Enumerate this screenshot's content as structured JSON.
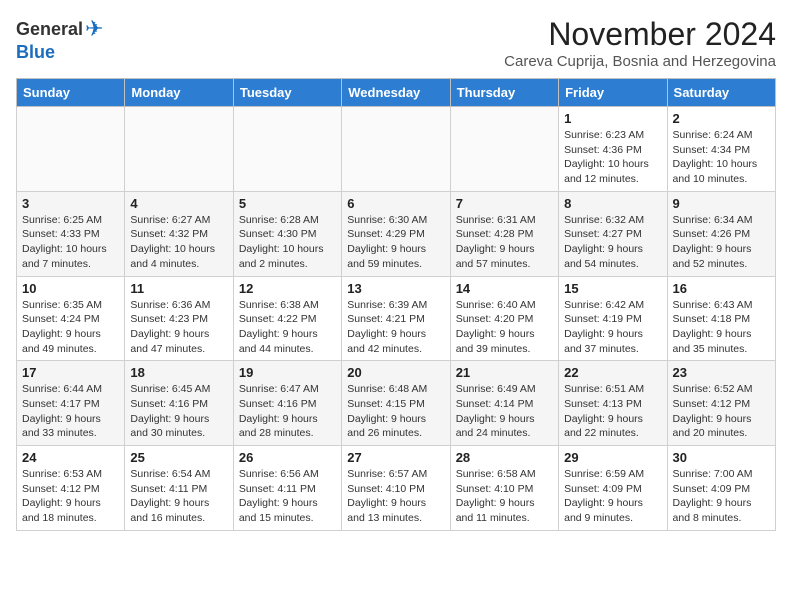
{
  "logo": {
    "general": "General",
    "blue": "Blue"
  },
  "title": "November 2024",
  "subtitle": "Careva Cuprija, Bosnia and Herzegovina",
  "days_of_week": [
    "Sunday",
    "Monday",
    "Tuesday",
    "Wednesday",
    "Thursday",
    "Friday",
    "Saturday"
  ],
  "weeks": [
    [
      {
        "day": "",
        "info": ""
      },
      {
        "day": "",
        "info": ""
      },
      {
        "day": "",
        "info": ""
      },
      {
        "day": "",
        "info": ""
      },
      {
        "day": "",
        "info": ""
      },
      {
        "day": "1",
        "info": "Sunrise: 6:23 AM\nSunset: 4:36 PM\nDaylight: 10 hours and 12 minutes."
      },
      {
        "day": "2",
        "info": "Sunrise: 6:24 AM\nSunset: 4:34 PM\nDaylight: 10 hours and 10 minutes."
      }
    ],
    [
      {
        "day": "3",
        "info": "Sunrise: 6:25 AM\nSunset: 4:33 PM\nDaylight: 10 hours and 7 minutes."
      },
      {
        "day": "4",
        "info": "Sunrise: 6:27 AM\nSunset: 4:32 PM\nDaylight: 10 hours and 4 minutes."
      },
      {
        "day": "5",
        "info": "Sunrise: 6:28 AM\nSunset: 4:30 PM\nDaylight: 10 hours and 2 minutes."
      },
      {
        "day": "6",
        "info": "Sunrise: 6:30 AM\nSunset: 4:29 PM\nDaylight: 9 hours and 59 minutes."
      },
      {
        "day": "7",
        "info": "Sunrise: 6:31 AM\nSunset: 4:28 PM\nDaylight: 9 hours and 57 minutes."
      },
      {
        "day": "8",
        "info": "Sunrise: 6:32 AM\nSunset: 4:27 PM\nDaylight: 9 hours and 54 minutes."
      },
      {
        "day": "9",
        "info": "Sunrise: 6:34 AM\nSunset: 4:26 PM\nDaylight: 9 hours and 52 minutes."
      }
    ],
    [
      {
        "day": "10",
        "info": "Sunrise: 6:35 AM\nSunset: 4:24 PM\nDaylight: 9 hours and 49 minutes."
      },
      {
        "day": "11",
        "info": "Sunrise: 6:36 AM\nSunset: 4:23 PM\nDaylight: 9 hours and 47 minutes."
      },
      {
        "day": "12",
        "info": "Sunrise: 6:38 AM\nSunset: 4:22 PM\nDaylight: 9 hours and 44 minutes."
      },
      {
        "day": "13",
        "info": "Sunrise: 6:39 AM\nSunset: 4:21 PM\nDaylight: 9 hours and 42 minutes."
      },
      {
        "day": "14",
        "info": "Sunrise: 6:40 AM\nSunset: 4:20 PM\nDaylight: 9 hours and 39 minutes."
      },
      {
        "day": "15",
        "info": "Sunrise: 6:42 AM\nSunset: 4:19 PM\nDaylight: 9 hours and 37 minutes."
      },
      {
        "day": "16",
        "info": "Sunrise: 6:43 AM\nSunset: 4:18 PM\nDaylight: 9 hours and 35 minutes."
      }
    ],
    [
      {
        "day": "17",
        "info": "Sunrise: 6:44 AM\nSunset: 4:17 PM\nDaylight: 9 hours and 33 minutes."
      },
      {
        "day": "18",
        "info": "Sunrise: 6:45 AM\nSunset: 4:16 PM\nDaylight: 9 hours and 30 minutes."
      },
      {
        "day": "19",
        "info": "Sunrise: 6:47 AM\nSunset: 4:16 PM\nDaylight: 9 hours and 28 minutes."
      },
      {
        "day": "20",
        "info": "Sunrise: 6:48 AM\nSunset: 4:15 PM\nDaylight: 9 hours and 26 minutes."
      },
      {
        "day": "21",
        "info": "Sunrise: 6:49 AM\nSunset: 4:14 PM\nDaylight: 9 hours and 24 minutes."
      },
      {
        "day": "22",
        "info": "Sunrise: 6:51 AM\nSunset: 4:13 PM\nDaylight: 9 hours and 22 minutes."
      },
      {
        "day": "23",
        "info": "Sunrise: 6:52 AM\nSunset: 4:12 PM\nDaylight: 9 hours and 20 minutes."
      }
    ],
    [
      {
        "day": "24",
        "info": "Sunrise: 6:53 AM\nSunset: 4:12 PM\nDaylight: 9 hours and 18 minutes."
      },
      {
        "day": "25",
        "info": "Sunrise: 6:54 AM\nSunset: 4:11 PM\nDaylight: 9 hours and 16 minutes."
      },
      {
        "day": "26",
        "info": "Sunrise: 6:56 AM\nSunset: 4:11 PM\nDaylight: 9 hours and 15 minutes."
      },
      {
        "day": "27",
        "info": "Sunrise: 6:57 AM\nSunset: 4:10 PM\nDaylight: 9 hours and 13 minutes."
      },
      {
        "day": "28",
        "info": "Sunrise: 6:58 AM\nSunset: 4:10 PM\nDaylight: 9 hours and 11 minutes."
      },
      {
        "day": "29",
        "info": "Sunrise: 6:59 AM\nSunset: 4:09 PM\nDaylight: 9 hours and 9 minutes."
      },
      {
        "day": "30",
        "info": "Sunrise: 7:00 AM\nSunset: 4:09 PM\nDaylight: 9 hours and 8 minutes."
      }
    ]
  ]
}
